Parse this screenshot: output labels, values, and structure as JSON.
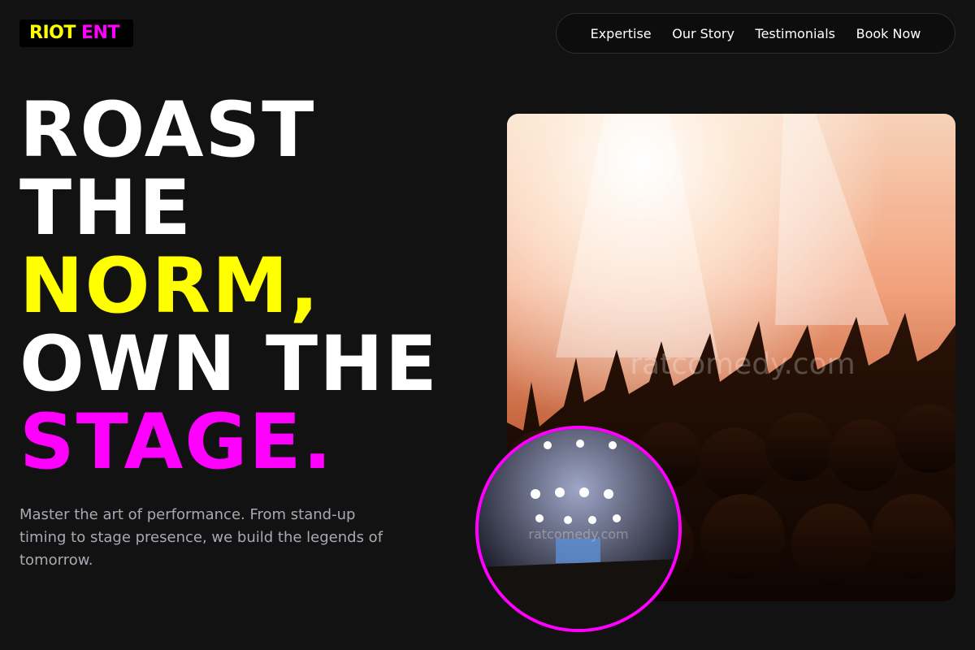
{
  "logo": {
    "part1": "RIOT",
    "part2": "ENT"
  },
  "nav": {
    "items": [
      "Expertise",
      "Our Story",
      "Testimonials",
      "Book Now"
    ]
  },
  "hero": {
    "line1": "ROAST",
    "line2": "THE",
    "line3": "NORM,",
    "line4": "OWN THE",
    "line5": "STAGE.",
    "description": "Master the art of performance. From stand-up timing to stage presence, we build the legends of tomorrow."
  },
  "images": {
    "main_watermark": "ratcomedy.com",
    "circle_watermark": "ratcomedy.com"
  },
  "colors": {
    "accent_yellow": "#ffff00",
    "accent_magenta": "#ff00ff",
    "background": "#121212"
  }
}
